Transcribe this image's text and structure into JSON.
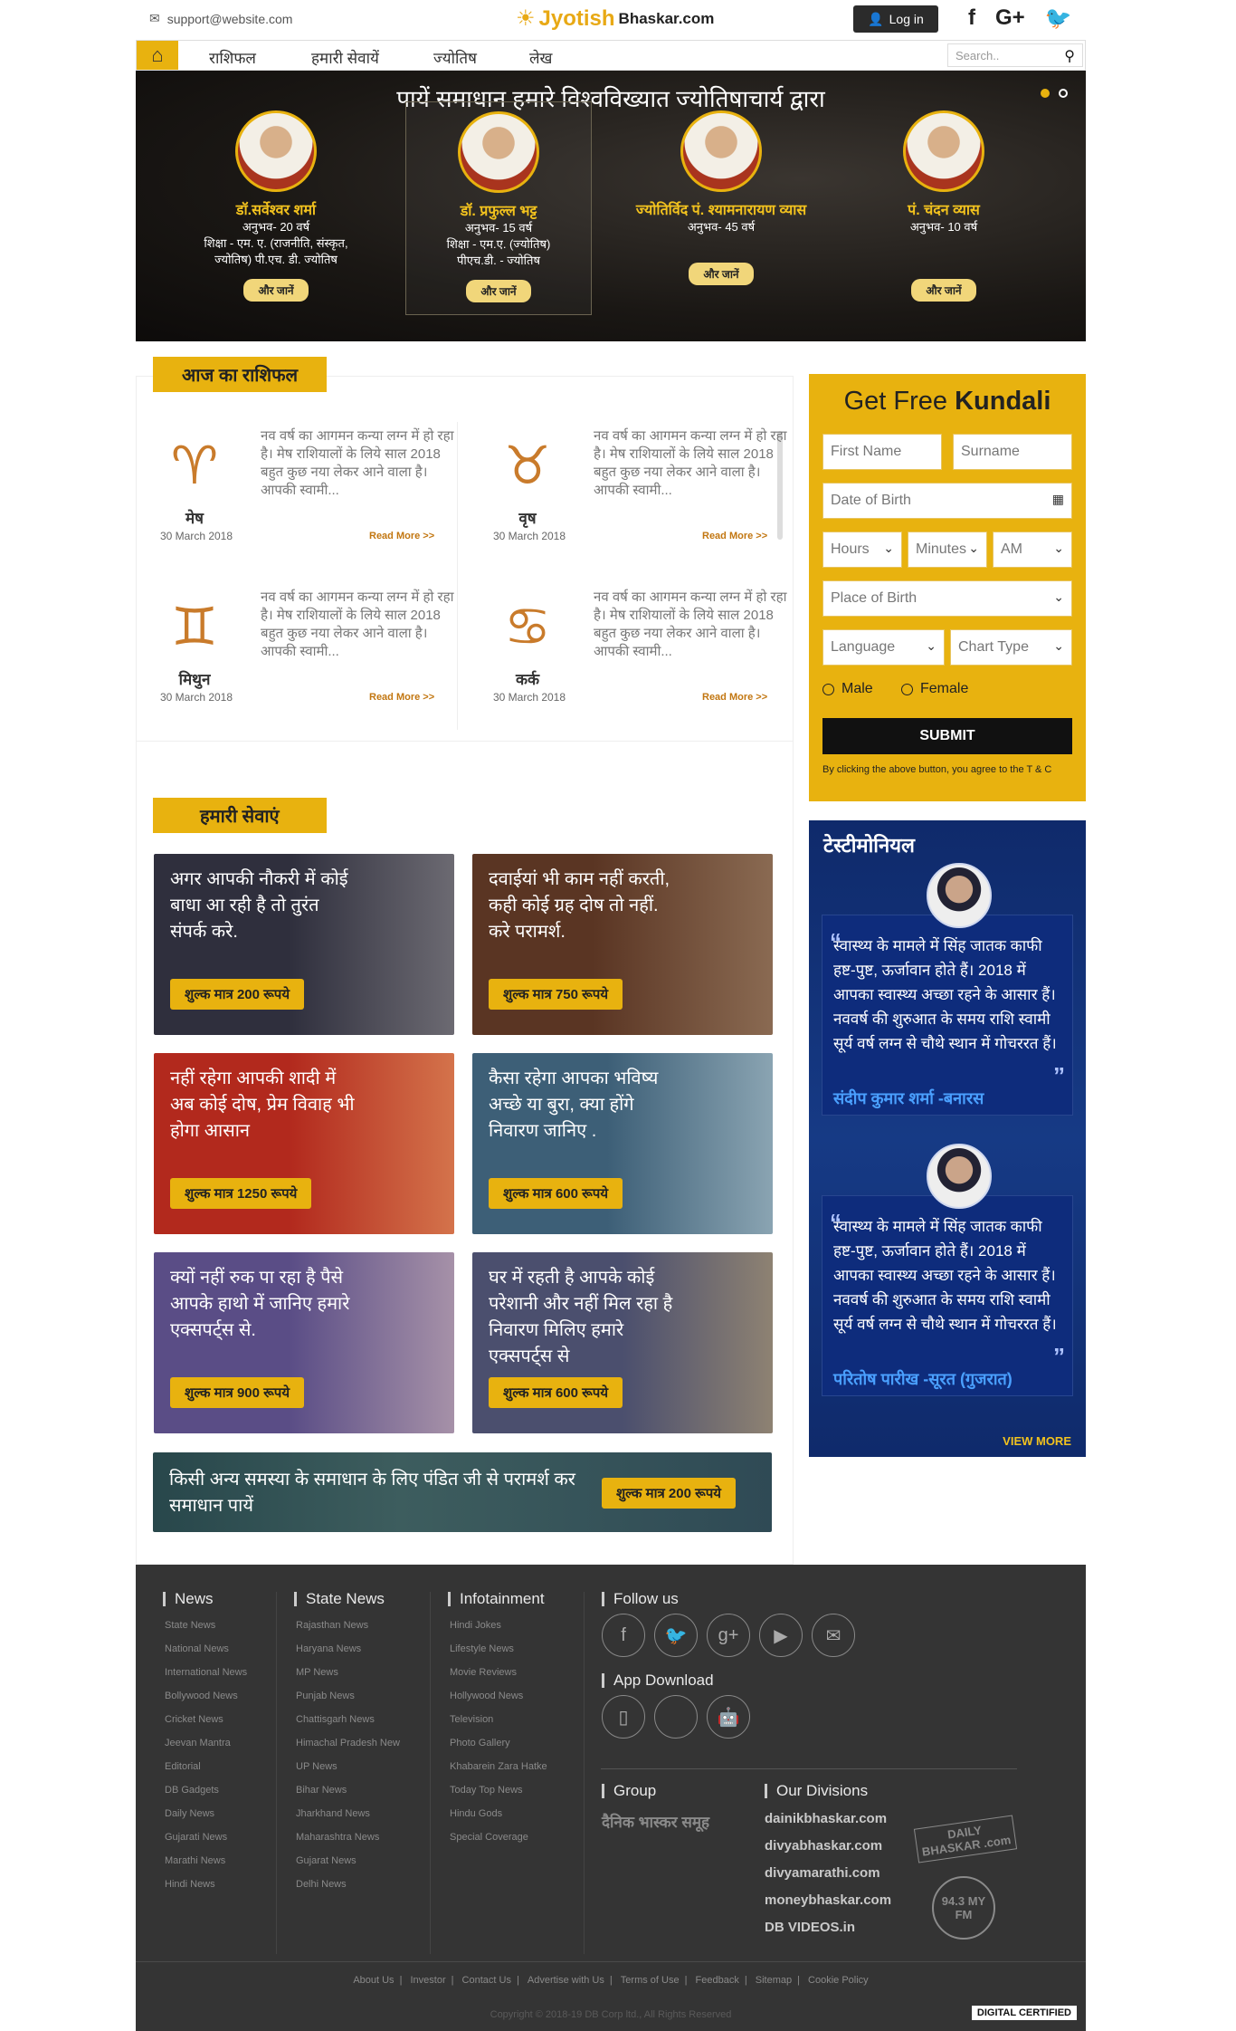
{
  "header": {
    "email": "support@website.com",
    "logo_main": "Jyotish",
    "logo_sub": "Bhaskar.com",
    "login_label": "Log in",
    "social": [
      "f",
      "G+",
      "t"
    ]
  },
  "nav": {
    "items": [
      "राशिफल",
      "हमारी सेवायें",
      "ज्योतिष",
      "लेख"
    ],
    "search_placeholder": "Search.."
  },
  "hero": {
    "title": "पायें समाधान हमारे विश्वविख्यात ज्योतिषाचार्य द्वारा",
    "experts": [
      {
        "name": "डॉ.सर्वेश्वर शर्मा",
        "lines": [
          "अनुभव- 20 वर्ष",
          "शिक्षा - एम. ए. (राजनीति, संस्कृत,",
          "ज्योतिष) पी.एच. डी. ज्योतिष"
        ],
        "more": "और जानें"
      },
      {
        "name": "डॉ. प्रफुल्ल भट्ट",
        "lines": [
          "अनुभव- 15 वर्ष",
          "शिक्षा - एम.ए. (ज्योतिष)",
          "पीएच.डी. - ज्योतिष"
        ],
        "more": "और जानें"
      },
      {
        "name": "ज्योतिर्विद पं. श्यामनारायण व्यास",
        "lines": [
          "अनुभव- 45 वर्ष"
        ],
        "more": "और जानें"
      },
      {
        "name": "पं. चंदन व्यास",
        "lines": [
          "अनुभव- 10 वर्ष"
        ],
        "more": "और जानें"
      }
    ]
  },
  "rashifal": {
    "heading": "आज का राशिफल",
    "read_more": "Read More >>",
    "items": [
      {
        "name": "मेष",
        "date": "30 March 2018",
        "text": "नव वर्ष का आगमन कन्या लग्न में हो रहा है। मेष राशियालों के लिये साल 2018 बहुत कुछ नया लेकर आने वाला है। आपकी स्वामी...",
        "icon": "ram-icon"
      },
      {
        "name": "वृष",
        "date": "30 March 2018",
        "text": "नव वर्ष का आगमन कन्या लग्न में हो रहा है। मेष राशियालों के लिये साल 2018 बहुत कुछ नया लेकर आने वाला है। आपकी स्वामी...",
        "icon": "bull-icon"
      },
      {
        "name": "मिथुन",
        "date": "30 March 2018",
        "text": "नव वर्ष का आगमन कन्या लग्न में हो रहा है। मेष राशियालों के लिये साल 2018 बहुत कुछ नया लेकर आने वाला है। आपकी स्वामी...",
        "icon": "twins-icon"
      },
      {
        "name": "कर्क",
        "date": "30 March 2018",
        "text": "नव वर्ष का आगमन कन्या लग्न में हो रहा है। मेष राशियालों के लिये साल 2018 बहुत कुछ नया लेकर आने वाला है। आपकी स्वामी...",
        "icon": "crab-icon"
      }
    ]
  },
  "services": {
    "heading": "हमारी सेवाएं",
    "items": [
      {
        "text": "अगर आपकी नौकरी में कोई बाधा आ रही है तो तुरंत संपर्क करे.",
        "price": "शुल्क मात्र 200 रूपये",
        "color": "#2f2f3d"
      },
      {
        "text": "दवाईयां भी काम नहीं करती, कही कोई ग्रह दोष तो नहीं. करे परामर्श.",
        "price": "शुल्क मात्र 750 रूपये",
        "color": "#5a3523"
      },
      {
        "text": "नहीं रहेगा आपकी शादी में अब कोई दोष, प्रेम विवाह भी होगा आसान",
        "price": "शुल्क मात्र 1250 रूपये",
        "color": "#b2291d"
      },
      {
        "text": "कैसा रहेगा आपका भविष्य अच्छे या बुरा, क्या होंगे निवारण जानिए .",
        "price": "शुल्क मात्र 600 रूपये",
        "color": "#3d5f77"
      },
      {
        "text": "क्यों नहीं रुक पा रहा है पैसे आपके हाथो में जानिए हमारे एक्सपर्ट्स से.",
        "price": "शुल्क मात्र 900 रूपये",
        "color": "#5a4d86"
      },
      {
        "text": "घर में रहती है आपके कोई परेशानी और नहीं मिल रहा है निवारण मिलिए हमारे एक्सपर्ट्स से",
        "price": "शुल्क मात्र 600 रूपये",
        "color": "#4b4f6e"
      }
    ],
    "banner_text": "किसी अन्य समस्या के समाधान के लिए पंडित जी से परामर्श कर समाधान पायें",
    "banner_price": "शुल्क मात्र 200 रूपये"
  },
  "kundali": {
    "title_a": "Get Free",
    "title_b": "Kundali",
    "first_name": "First Name",
    "surname": "Surname",
    "dob": "Date of Birth",
    "hours": "Hours",
    "minutes": "Minutes",
    "ampm": "AM",
    "place": "Place of Birth",
    "language": "Language",
    "chart_type": "Chart Type",
    "male": "Male",
    "female": "Female",
    "submit": "SUBMIT",
    "agree": "By clicking the above button, you agree to the T & C"
  },
  "testimonials": {
    "heading": "टेस्टीमोनियल",
    "items": [
      {
        "text": "स्वास्थ्य के मामले में सिंह जातक काफी हष्ट-पुष्ट, ऊर्जावान होते हैं। 2018 में आपका स्वास्थ्य अच्छा रहने के आसार हैं। नववर्ष की शुरुआत के समय राशि स्वामी सूर्य वर्ष लग्न से चौथे स्थान में गोचररत हैं।",
        "author": "संदीप कुमार शर्मा  -बनारस"
      },
      {
        "text": "स्वास्थ्य के मामले में सिंह जातक काफी हष्ट-पुष्ट, ऊर्जावान होते हैं। 2018 में आपका स्वास्थ्य अच्छा रहने के आसार हैं। नववर्ष की शुरुआत के समय राशि स्वामी सूर्य वर्ष लग्न से चौथे स्थान में गोचररत हैं।",
        "author": "परितोष पारीख  -सूरत (गुजरात)"
      }
    ],
    "view_more": "VIEW MORE"
  },
  "footer": {
    "news": {
      "heading": "News",
      "links": [
        "State News",
        "National News",
        "International News",
        "Bollywood News",
        "Cricket News",
        "Jeevan Mantra",
        "Editorial",
        "DB Gadgets",
        "Daily News",
        "Gujarati News",
        "Marathi News",
        "Hindi News"
      ]
    },
    "state_news": {
      "heading": "State News",
      "links": [
        "Rajasthan News",
        "Haryana News",
        "MP News",
        "Punjab News",
        "Chattisgarh News",
        "Himachal Pradesh New",
        "UP News",
        "Bihar News",
        "Jharkhand News",
        "Maharashtra News",
        "Gujarat News",
        "Delhi News"
      ]
    },
    "infotainment": {
      "heading": "Infotainment",
      "links": [
        "Hindi Jokes",
        "Lifestyle News",
        "Movie Reviews",
        "Hollywood News",
        "Television",
        "Photo Gallery",
        "Khabarein Zara Hatke",
        "Today Top News",
        "Hindu Gods",
        "Special Coverage"
      ]
    },
    "follow_us": "Follow us",
    "app_download": "App Download",
    "group": "Group",
    "group_logo": "दैनिक भास्कर समूह",
    "divisions_heading": "Our Divisions",
    "divisions": [
      "dainikbhaskar.com",
      "divyabhaskar.com",
      "divyamarathi.com",
      "moneybhaskar.com",
      "DB VIDEOS.in"
    ],
    "divisions_badges": [
      "DAILY BHASKAR .com",
      "94.3 MY FM"
    ],
    "bottom_links": [
      "About Us",
      "Investor",
      "Contact Us",
      "Advertise with Us",
      "Terms of Use",
      "Feedback",
      "Sitemap",
      "Cookie Policy"
    ],
    "copyright": "Copyright © 2018-19 DB Corp ltd., All Rights Reserved",
    "cert": "DIGITAL CERTIFIED"
  }
}
